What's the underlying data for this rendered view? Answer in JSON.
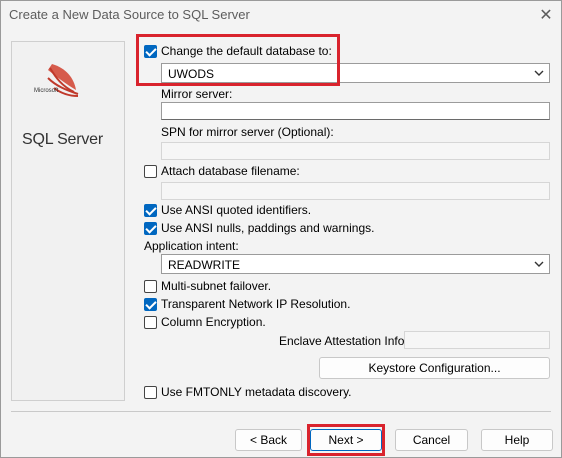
{
  "window": {
    "title": "Create a New Data Source to SQL Server"
  },
  "logo": {
    "microsoft": "Microsoft",
    "product": "SQL Server"
  },
  "options": {
    "change_default_db": {
      "label": "Change the default database to:",
      "checked": true,
      "value": "UWODS"
    },
    "mirror_server": {
      "label": "Mirror server:",
      "value": ""
    },
    "spn_mirror": {
      "label": "SPN for mirror server (Optional):",
      "value": ""
    },
    "attach_db": {
      "label": "Attach database filename:",
      "checked": false,
      "value": ""
    },
    "ansi_quoted": {
      "label": "Use ANSI quoted identifiers.",
      "checked": true
    },
    "ansi_nulls": {
      "label": "Use ANSI nulls, paddings and warnings.",
      "checked": true
    },
    "app_intent": {
      "label": "Application intent:",
      "value": "READWRITE"
    },
    "multi_subnet": {
      "label": "Multi-subnet failover.",
      "checked": false
    },
    "tnir": {
      "label": "Transparent Network IP Resolution.",
      "checked": true
    },
    "column_encryption": {
      "label": "Column Encryption.",
      "checked": false
    },
    "enclave": {
      "label": "Enclave Attestation Info:",
      "value": ""
    },
    "keystore_button": "Keystore Configuration...",
    "fmtonly": {
      "label": "Use FMTONLY metadata discovery.",
      "checked": false
    }
  },
  "buttons": {
    "back": "< Back",
    "next": "Next >",
    "cancel": "Cancel",
    "help": "Help"
  },
  "colors": {
    "accent": "#0067c0",
    "highlight": "#d9232d"
  }
}
